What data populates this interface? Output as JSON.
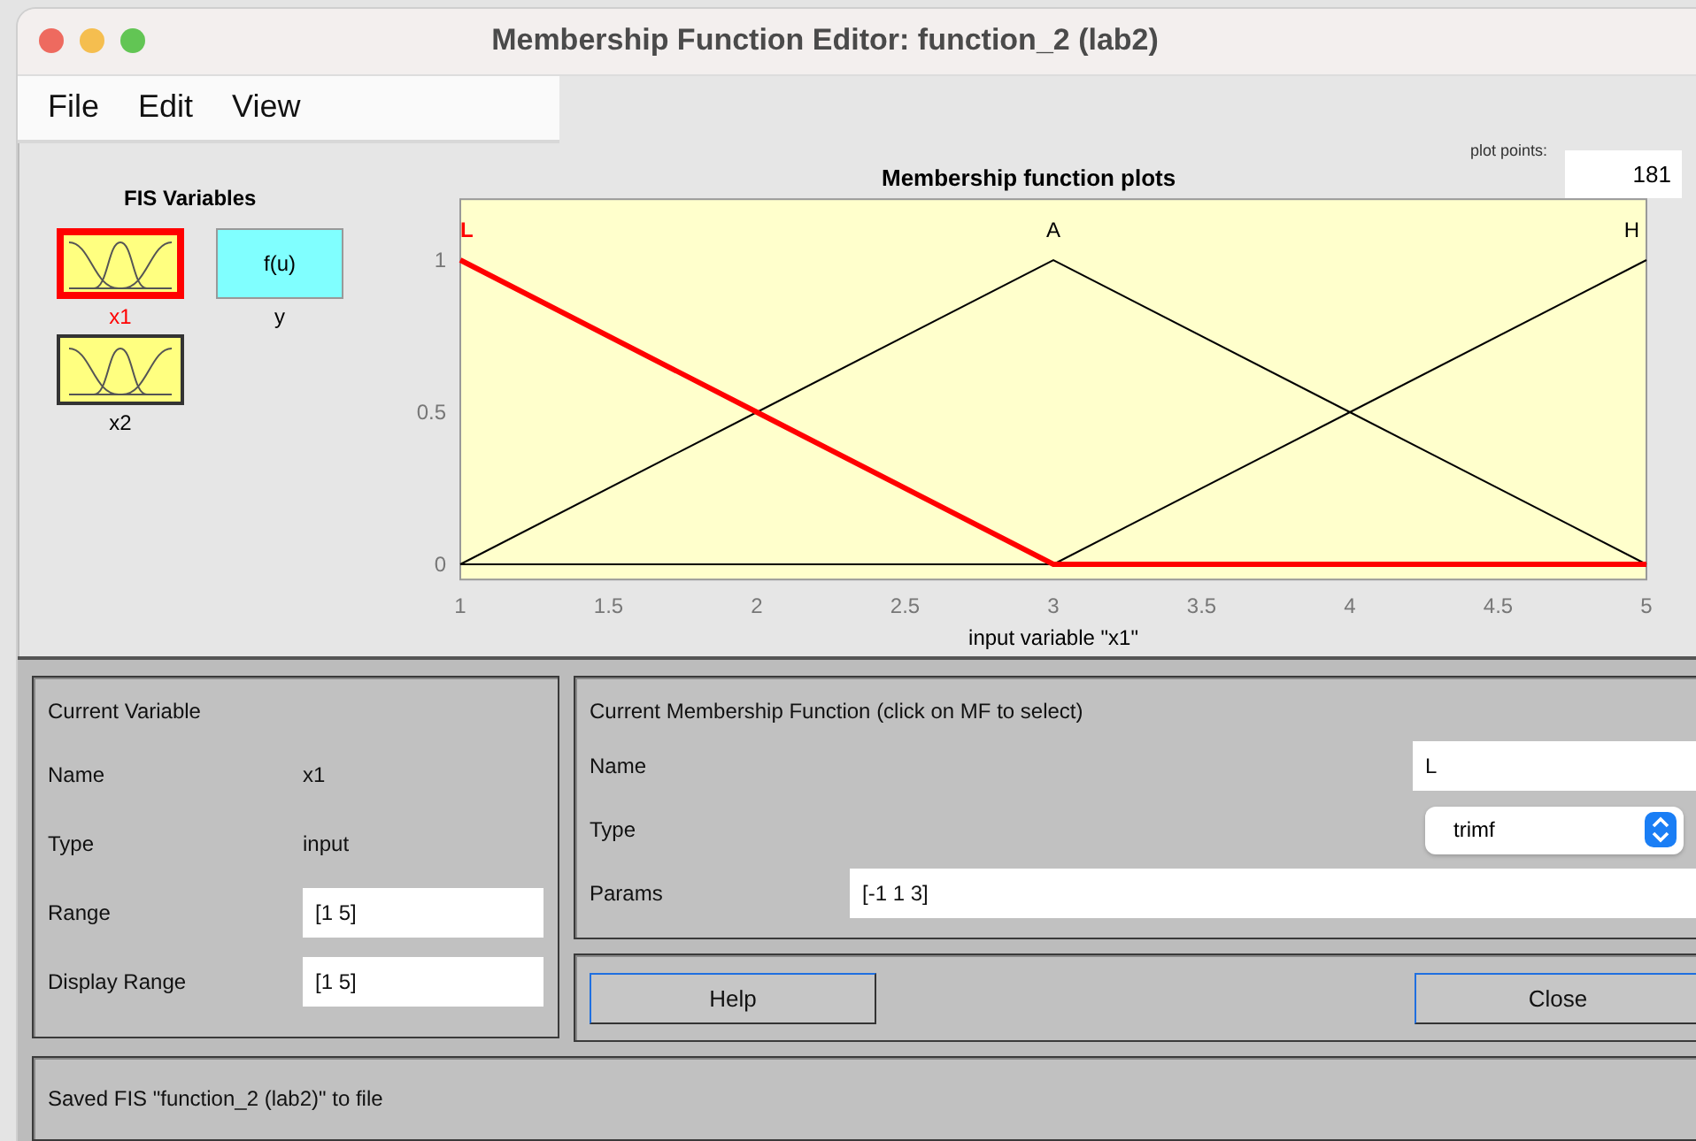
{
  "window": {
    "title": "Membership Function Editor: function_2 (lab2)"
  },
  "menu": [
    "File",
    "Edit",
    "View"
  ],
  "fis_variables": {
    "title": "FIS Variables",
    "items": [
      {
        "label": "x1",
        "kind": "input",
        "selected": true
      },
      {
        "label": "y",
        "kind": "output",
        "selected": false,
        "text": "f(u)"
      },
      {
        "label": "x2",
        "kind": "input",
        "selected": false
      }
    ]
  },
  "plot_points": {
    "label": "plot points:",
    "value": "181"
  },
  "plot": {
    "chart_data": {
      "type": "line",
      "title": "Membership function plots",
      "xlabel": "input variable \"x1\"",
      "x": [
        1,
        2,
        3,
        4,
        5
      ],
      "xlim": [
        1,
        5
      ],
      "ylim": [
        -0.05,
        1.2
      ],
      "xticks": [
        1,
        1.5,
        2,
        2.5,
        3,
        3.5,
        4,
        4.5,
        5
      ],
      "yticks": [
        0,
        0.5,
        1
      ],
      "series": [
        {
          "name": "L",
          "color": "#ff0000",
          "values": [
            1,
            0.5,
            0,
            0,
            0
          ]
        },
        {
          "name": "A",
          "color": "#000000",
          "values": [
            0,
            0.5,
            1,
            0.5,
            0
          ]
        },
        {
          "name": "H",
          "color": "#000000",
          "values": [
            null,
            null,
            0,
            0.5,
            1
          ]
        }
      ]
    }
  },
  "current_variable": {
    "title": "Current Variable",
    "rows": [
      {
        "label": "Name",
        "value": "x1",
        "kind": "text"
      },
      {
        "label": "Type",
        "value": "input",
        "kind": "text"
      },
      {
        "label": "Range",
        "value": "[1 5]",
        "kind": "field"
      },
      {
        "label": "Display Range",
        "value": "[1 5]",
        "kind": "field"
      }
    ]
  },
  "current_mf": {
    "title": "Current Membership Function (click on MF to select)",
    "name": {
      "label": "Name",
      "value": "L"
    },
    "type": {
      "label": "Type",
      "value": "trimf"
    },
    "params": {
      "label": "Params",
      "value": "[-1 1 3]"
    }
  },
  "buttons": [
    "Help",
    "Close"
  ],
  "status_bar": "Saved FIS \"function_2 (lab2)\" to file"
}
